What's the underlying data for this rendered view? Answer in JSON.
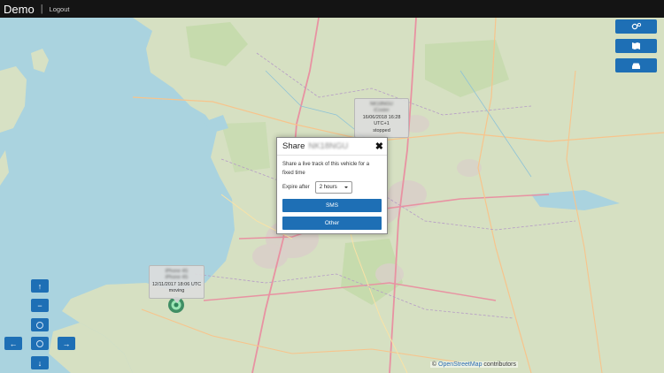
{
  "topbar": {
    "brand": "Demo",
    "separator": "|",
    "logout": "Logout"
  },
  "map": {
    "attribution_prefix": "©",
    "attribution_link": "OpenStreetMap",
    "attribution_suffix": "contributors"
  },
  "right_buttons": [
    {
      "icon": "cogs-icon"
    },
    {
      "icon": "flag-icon"
    },
    {
      "icon": "car-icon"
    }
  ],
  "nav_buttons": {
    "up": "↑",
    "left": "←",
    "right": "→",
    "down": "↓",
    "zoom_in": "+",
    "zoom_out": "−"
  },
  "popup_vehicle": {
    "name": "NK18NGU",
    "sub": "iCoster",
    "timestamp": "16/06/2018 16:28 UTC+1",
    "status": "stopped"
  },
  "popup_phone": {
    "name": "iPhone 4S",
    "sub": "iPhone 4S",
    "timestamp": "12/11/2017 18:06 UTC",
    "status": "moving"
  },
  "modal": {
    "title": "Share",
    "plate": "NK18NGU",
    "close": "✖",
    "message": "Share a live track of this vehicle for a fixed time",
    "expire_label": "Expire after",
    "expire_value": "2 hours",
    "sms_button": "SMS",
    "other_button": "Other"
  }
}
